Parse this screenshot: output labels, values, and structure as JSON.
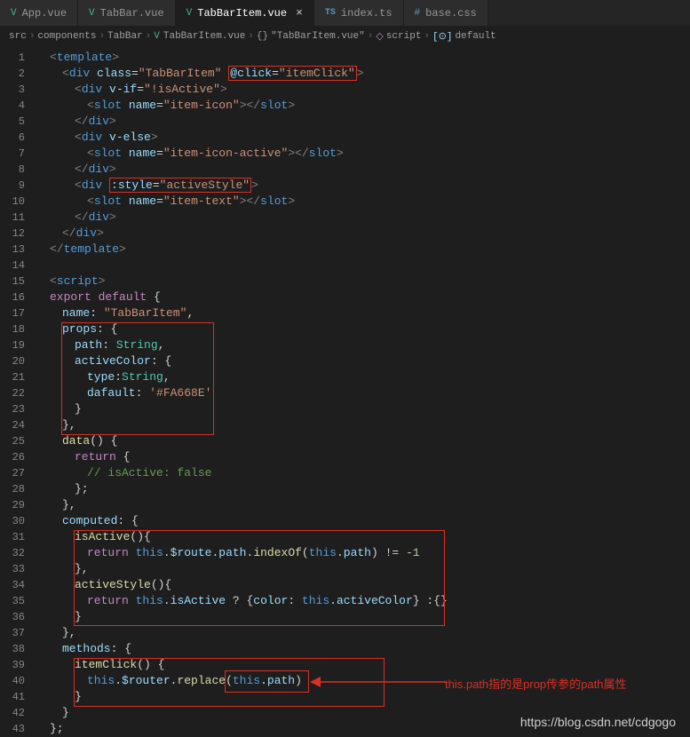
{
  "tabs": [
    {
      "label": "App.vue",
      "icon": "V",
      "iconClass": "vue-icon",
      "active": false
    },
    {
      "label": "TabBar.vue",
      "icon": "V",
      "iconClass": "vue-icon",
      "active": false
    },
    {
      "label": "TabBarItem.vue",
      "icon": "V",
      "iconClass": "vue-icon",
      "active": true
    },
    {
      "label": "index.ts",
      "icon": "TS",
      "iconClass": "ts-icon",
      "active": false
    },
    {
      "label": "base.css",
      "icon": "#",
      "iconClass": "css-icon",
      "active": false
    }
  ],
  "breadcrumb": {
    "parts": [
      {
        "text": "src",
        "icon": ""
      },
      {
        "text": "components",
        "icon": ""
      },
      {
        "text": "TabBar",
        "icon": ""
      },
      {
        "text": "TabBarItem.vue",
        "icon": "V",
        "iconClass": "bc-vue"
      },
      {
        "text": "\"TabBarItem.vue\"",
        "icon": "{}",
        "iconClass": ""
      },
      {
        "text": "script",
        "icon": "◇",
        "iconClass": "bc-script-icon"
      },
      {
        "text": "default",
        "icon": "[⊙]",
        "iconClass": "bc-obj-icon"
      }
    ]
  },
  "lines": {
    "l1": "<template>",
    "l2a": "<div ",
    "l2b": "class",
    "l2c": "=",
    "l2d": "\"TabBarItem\"",
    "l2e_hl": "@click=\"itemClick\"",
    "l2f": ">",
    "l3": "<div v-if=\"!isActive\">",
    "l4": "<slot name=\"item-icon\"></slot>",
    "l5": "</div>",
    "l6": "<div v-else>",
    "l7": "<slot name=\"item-icon-active\"></slot>",
    "l8": "</div>",
    "l9a": "<div ",
    "l9_hl": ":style=\"activeStyle\"",
    "l9b": ">",
    "l10": "<slot name=\"item-text\"></slot>",
    "l11": "</div>",
    "l12": "</div>",
    "l13": "</template>",
    "l14": "",
    "l15": "<script>",
    "l16": "export default {",
    "l17": "name: \"TabBarItem\",",
    "l18": "props: {",
    "l19": "path: String,",
    "l20": "activeColor: {",
    "l21": "type:String,",
    "l22": "dafault: '#FA668E'",
    "l23": "}",
    "l24": "},",
    "l25": "data() {",
    "l26": "return {",
    "l27": "// isActive: false",
    "l28": "};",
    "l29": "},",
    "l30": "computed: {",
    "l31": "isActive(){",
    "l32": "return this.$route.path.indexOf(this.path) != -1",
    "l33": "},",
    "l34": "activeStyle(){",
    "l35": "return this.isActive ? {color: this.activeColor} :{}",
    "l36": "}",
    "l37": "},",
    "l38": "methods: {",
    "l39": "itemClick() {",
    "l40a": "this.$router.replace(",
    "l40_hl": "this.path",
    "l40b": ")",
    "l41": "}",
    "l42": "}",
    "l43": "};"
  },
  "annotation": "this.path指的是prop传参的path属性",
  "watermark": "https://blog.csdn.net/cdgogo"
}
